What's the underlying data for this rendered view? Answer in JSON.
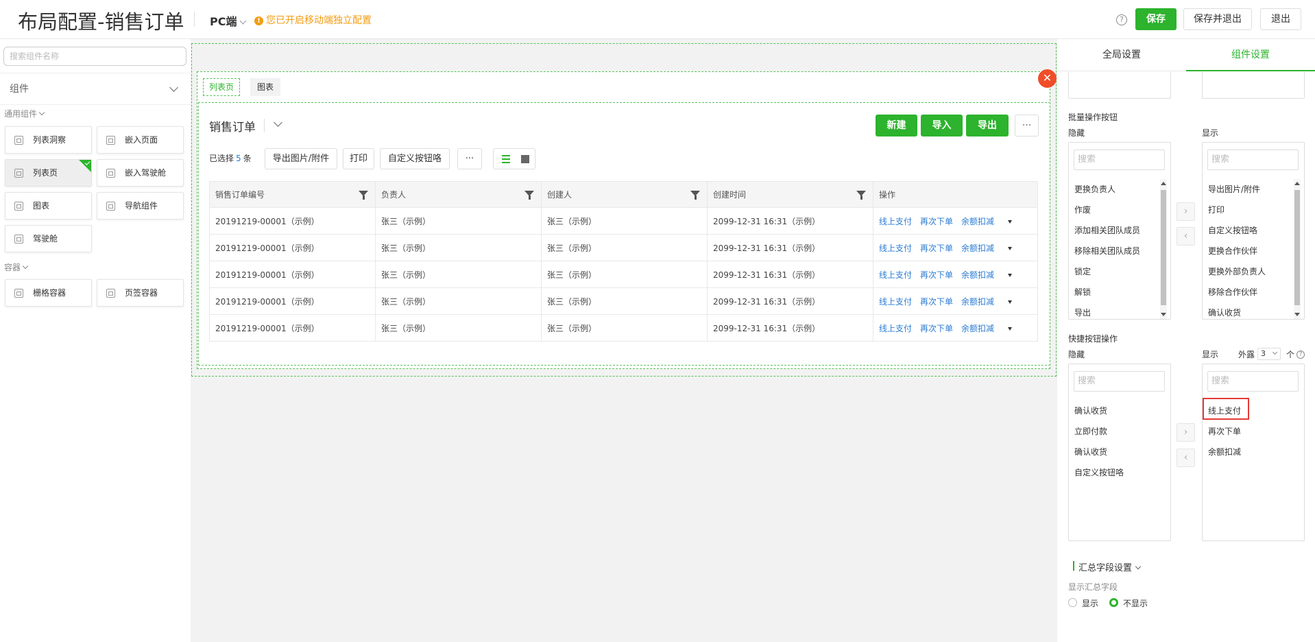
{
  "header": {
    "title": "布局配置-销售订单",
    "platform": "PC端",
    "warning": "您已开启移动端独立配置",
    "help": "?",
    "save": "保存",
    "save_exit": "保存并退出",
    "exit": "退出"
  },
  "left": {
    "search_placeholder": "搜索组件名称",
    "category": "组件",
    "group_general": "通用组件",
    "group_container": "容器",
    "general_items": [
      "列表洞察",
      "嵌入页面",
      "列表页",
      "嵌入驾驶舱",
      "图表",
      "导航组件",
      "驾驶舱"
    ],
    "container_items": [
      "栅格容器",
      "页签容器"
    ]
  },
  "canvas": {
    "close": "✕",
    "tabs": [
      "列表页",
      "图表"
    ],
    "page_title": "销售订单",
    "buttons": {
      "new": "新建",
      "import": "导入",
      "export": "导出",
      "more": "···"
    },
    "selected_prefix": "已选择",
    "selected_count": "5",
    "selected_suffix": "条",
    "toolbar": [
      "导出图片/附件",
      "打印",
      "自定义按钮咯",
      "···"
    ],
    "columns": [
      "销售订单编号",
      "负责人",
      "创建人",
      "创建时间",
      "操作"
    ],
    "rows": [
      {
        "no": "20191219-00001（示例）",
        "owner": "张三（示例）",
        "creator": "张三（示例）",
        "time": "2099-12-31 16:31（示例）"
      },
      {
        "no": "20191219-00001（示例）",
        "owner": "张三（示例）",
        "creator": "张三（示例）",
        "time": "2099-12-31 16:31（示例）"
      },
      {
        "no": "20191219-00001（示例）",
        "owner": "张三（示例）",
        "creator": "张三（示例）",
        "time": "2099-12-31 16:31（示例）"
      },
      {
        "no": "20191219-00001（示例）",
        "owner": "张三（示例）",
        "creator": "张三（示例）",
        "time": "2099-12-31 16:31（示例）"
      },
      {
        "no": "20191219-00001（示例）",
        "owner": "张三（示例）",
        "creator": "张三（示例）",
        "time": "2099-12-31 16:31（示例）"
      }
    ],
    "row_actions": [
      "线上支付",
      "再次下单",
      "余额扣减"
    ]
  },
  "right": {
    "tabs": [
      "全局设置",
      "组件设置"
    ],
    "batch_title": "批量操作按钮",
    "hidden": "隐藏",
    "shown": "显示",
    "search": "搜索",
    "batch_hidden": [
      "更换负责人",
      "作废",
      "添加相关团队成员",
      "移除相关团队成员",
      "锁定",
      "解锁",
      "导出"
    ],
    "batch_shown": [
      "导出图片/附件",
      "打印",
      "自定义按钮咯",
      "更换合作伙伴",
      "更换外部负责人",
      "移除合作伙伴",
      "确认收货"
    ],
    "quick_title": "快捷按钮操作",
    "expose_label": "外露",
    "expose_value": "3",
    "expose_unit": "个",
    "quick_hidden": [
      "确认收货",
      "立即付款",
      "确认收货",
      "自定义按钮咯"
    ],
    "quick_shown": [
      "线上支付",
      "再次下单",
      "余额扣减"
    ],
    "summary_title": "汇总字段设置",
    "summary_label": "显示汇总字段",
    "opt_show": "显示",
    "opt_hide": "不显示",
    "arrow_right": "›",
    "arrow_left": "‹"
  },
  "colors": {
    "accent": "#2db32d",
    "warning": "#f39c12",
    "link": "#2a7bd4",
    "close": "#f04e28"
  }
}
